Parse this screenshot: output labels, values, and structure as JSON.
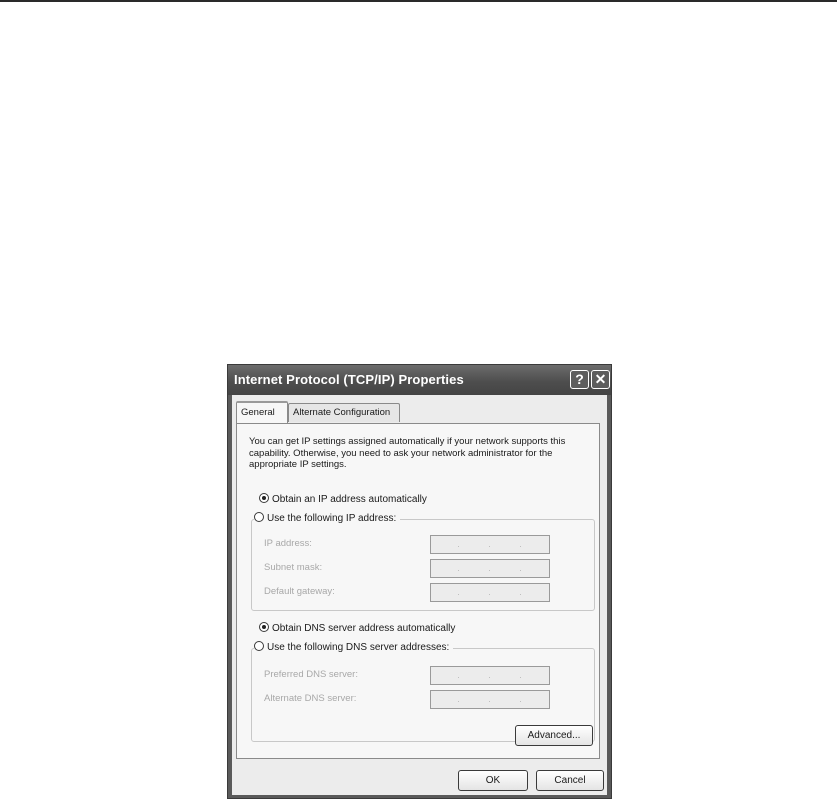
{
  "dialog": {
    "title": "Internet Protocol (TCP/IP) Properties",
    "help_button": "?",
    "close_button": "✕"
  },
  "tabs": [
    {
      "label": "General",
      "active": true
    },
    {
      "label": "Alternate Configuration",
      "active": false
    }
  ],
  "general": {
    "intro": "You can get IP settings assigned automatically if your network supports this capability. Otherwise, you need to ask your network administrator for the appropriate IP settings.",
    "ip_auto_label": "Obtain an IP address automatically",
    "ip_manual_label": "Use the following IP address:",
    "ip_fields": [
      {
        "label": "IP address:",
        "value": ". . ."
      },
      {
        "label": "Subnet mask:",
        "value": ". . ."
      },
      {
        "label": "Default gateway:",
        "value": ". . ."
      }
    ],
    "dns_auto_label": "Obtain DNS server address automatically",
    "dns_manual_label": "Use the following DNS server addresses:",
    "dns_fields": [
      {
        "label": "Preferred DNS server:",
        "value": ". . ."
      },
      {
        "label": "Alternate DNS server:",
        "value": ". . ."
      }
    ],
    "advanced_button": "Advanced..."
  },
  "footer": {
    "ok_button": "OK",
    "cancel_button": "Cancel"
  }
}
